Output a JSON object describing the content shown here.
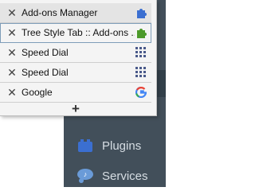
{
  "tabs": [
    {
      "title": "Add-ons Manager",
      "icon": "puzzle-icon",
      "active": true
    },
    {
      "title": "Tree Style Tab :: Add-ons ...",
      "icon": "green-puzzle-icon",
      "active": false
    },
    {
      "title": "Speed Dial",
      "icon": "grid-icon",
      "active": false
    },
    {
      "title": "Speed Dial",
      "icon": "grid-icon",
      "active": false
    },
    {
      "title": "Google",
      "icon": "google-icon",
      "active": false
    }
  ],
  "new_tab_label": "+",
  "background": {
    "sidebar_items": [
      {
        "label": "Plugins",
        "icon": "plugin-icon"
      },
      {
        "label": "Services",
        "icon": "services-icon"
      }
    ]
  },
  "colors": {
    "sidebar": "#424f5a",
    "accent_blue": "#3b6fd1",
    "puzzle_green": "#4c9a2a"
  }
}
